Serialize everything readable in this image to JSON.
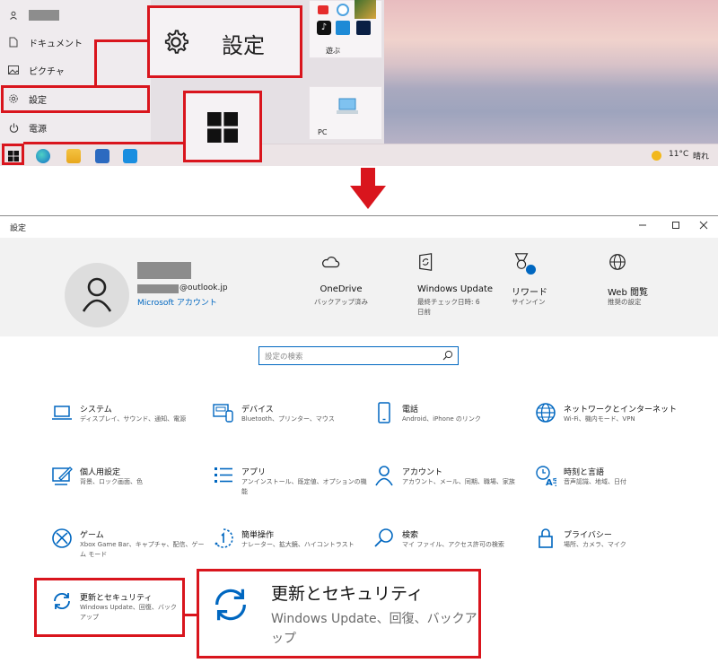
{
  "start_menu": {
    "items": [
      {
        "label": "ドキュメント",
        "icon": "document-icon"
      },
      {
        "label": "ピクチャ",
        "icon": "picture-icon"
      },
      {
        "label": "設定",
        "icon": "gear-icon"
      },
      {
        "label": "電源",
        "icon": "power-icon"
      }
    ],
    "tile_label_games": "遊ぶ",
    "tile_label_pc": "PC",
    "callout_settings_label": "設定"
  },
  "taskbar": {
    "temperature": "11°C",
    "weather": "晴れ"
  },
  "settings_window": {
    "title": "設定",
    "account": {
      "email_suffix": "@outlook.jp",
      "account_link": "Microsoft アカウント"
    },
    "header_items": [
      {
        "name": "OneDrive",
        "sub": "バックアップ済み",
        "icon": "cloud-icon"
      },
      {
        "name": "Windows Update",
        "sub": "最終チェック日時: 6 日前",
        "icon": "sync-icon"
      },
      {
        "name": "リワード",
        "sub": "サインイン",
        "icon": "reward-medal-icon"
      },
      {
        "name": "Web 閲覧",
        "sub": "推奨の設定",
        "icon": "globe-icon"
      }
    ],
    "search_placeholder": "設定の検索",
    "categories": [
      {
        "name": "システム",
        "desc": "ディスプレイ、サウンド、通知、電源",
        "icon": "laptop-icon"
      },
      {
        "name": "デバイス",
        "desc": "Bluetooth、プリンター、マウス",
        "icon": "devices-icon"
      },
      {
        "name": "電話",
        "desc": "Android、iPhone のリンク",
        "icon": "phone-icon"
      },
      {
        "name": "ネットワークとインターネット",
        "desc": "Wi-Fi、機内モード、VPN",
        "icon": "network-globe-icon"
      },
      {
        "name": "個人用設定",
        "desc": "背景、ロック画面、色",
        "icon": "personalization-icon"
      },
      {
        "name": "アプリ",
        "desc": "アンインストール、既定値、オプションの機能",
        "icon": "apps-list-icon"
      },
      {
        "name": "アカウント",
        "desc": "アカウント、メール、同期、職場、家族",
        "icon": "person-icon"
      },
      {
        "name": "時刻と言語",
        "desc": "音声認識、地域、日付",
        "icon": "time-language-icon"
      },
      {
        "name": "ゲーム",
        "desc": "Xbox Game Bar、キャプチャ、配信、ゲーム モード",
        "icon": "xbox-icon"
      },
      {
        "name": "簡単操作",
        "desc": "ナレーター、拡大鏡、ハイコントラスト",
        "icon": "ease-of-access-icon"
      },
      {
        "name": "検索",
        "desc": "マイ ファイル、アクセス許可の検索",
        "icon": "search-icon"
      },
      {
        "name": "プライバシー",
        "desc": "場所、カメラ、マイク",
        "icon": "lock-icon"
      },
      {
        "name": "更新とセキュリティ",
        "desc": "Windows Update、回復、バックアップ",
        "icon": "update-sync-icon"
      }
    ],
    "zoom_callout": {
      "name": "更新とセキュリティ",
      "desc": "Windows Update、回復、バックアップ"
    }
  },
  "colors": {
    "accent": "#0067c0",
    "highlight_red": "#d9151d"
  }
}
